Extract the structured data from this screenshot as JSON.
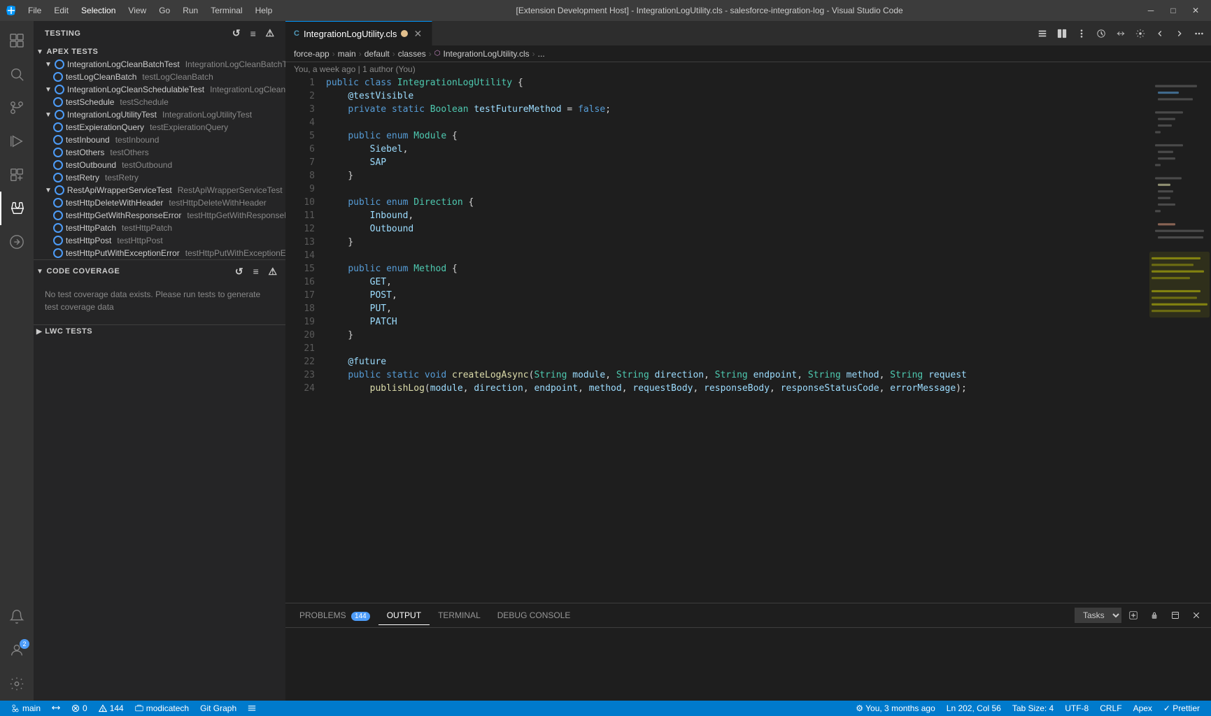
{
  "titlebar": {
    "title": "[Extension Development Host] - IntegrationLogUtility.cls - salesforce-integration-log - Visual Studio Code",
    "icon": "⬡",
    "menu": [
      "File",
      "Edit",
      "Selection",
      "View",
      "Go",
      "Run",
      "Terminal",
      "Help"
    ],
    "controls": {
      "minimize": "─",
      "maximize": "□",
      "close": "✕"
    }
  },
  "activitybar": {
    "items": [
      {
        "name": "explorer",
        "icon": "⊞",
        "active": false
      },
      {
        "name": "search",
        "icon": "🔍",
        "active": false
      },
      {
        "name": "source-control",
        "icon": "⑂",
        "active": false
      },
      {
        "name": "run-debug",
        "icon": "▷",
        "active": false
      },
      {
        "name": "extensions",
        "icon": "⊡",
        "active": false
      },
      {
        "name": "testing",
        "icon": "⚗",
        "active": true
      },
      {
        "name": "salesforce",
        "icon": "☁",
        "active": false
      },
      {
        "name": "bottom1",
        "icon": "🔔",
        "active": false
      },
      {
        "name": "bottom2",
        "icon": "👤",
        "badge": "2",
        "active": false
      },
      {
        "name": "settings",
        "icon": "⚙",
        "active": false
      }
    ]
  },
  "sidebar": {
    "title": "TESTING",
    "actions": [
      "↺",
      "≡",
      "⚠"
    ],
    "apex_section": {
      "label": "APEX TESTS",
      "expanded": true,
      "test_suites": [
        {
          "name": "IntegrationLogCleanBatchTest",
          "label": "IntegrationLogCleanBatchTest",
          "secondary": "IntegrationLogCleanBatchTest",
          "expanded": true,
          "children": [
            {
              "label": "testLogCleanBatch",
              "secondary": "testLogCleanBatch"
            }
          ]
        },
        {
          "name": "IntegrationLogCleanSchedulableTest",
          "label": "IntegrationLogCleanSchedulableTest",
          "secondary": "IntegrationLogCleanSchedula...",
          "expanded": true,
          "children": [
            {
              "label": "testSchedule",
              "secondary": "testSchedule"
            }
          ]
        },
        {
          "name": "IntegrationLogUtilityTest",
          "label": "IntegrationLogUtilityTest",
          "secondary": "IntegrationLogUtilityTest",
          "expanded": true,
          "children": [
            {
              "label": "testExpierationQuery",
              "secondary": "testExpierationQuery"
            },
            {
              "label": "testInbound",
              "secondary": "testInbound"
            },
            {
              "label": "testOthers",
              "secondary": "testOthers"
            },
            {
              "label": "testOutbound",
              "secondary": "testOutbound"
            },
            {
              "label": "testRetry",
              "secondary": "testRetry"
            }
          ]
        },
        {
          "name": "RestApiWrapperServiceTest",
          "label": "RestApiWrapperServiceTest",
          "secondary": "RestApiWrapperServiceTest",
          "expanded": true,
          "children": [
            {
              "label": "testHttpDeleteWithHeader",
              "secondary": "testHttpDeleteWithHeader"
            },
            {
              "label": "testHttpGetWithResponseError",
              "secondary": "testHttpGetWithResponseError"
            },
            {
              "label": "testHttpPatch",
              "secondary": "testHttpPatch"
            },
            {
              "label": "testHttpPost",
              "secondary": "testHttpPost"
            },
            {
              "label": "testHttpPutWithExceptionError",
              "secondary": "testHttpPutWithExceptionError"
            }
          ]
        }
      ]
    },
    "coverage_section": {
      "label": "CODE COVERAGE",
      "expanded": true,
      "actions": [
        "↺",
        "≡",
        "⚠"
      ],
      "message": "No test coverage data exists. Please run tests to generate test coverage data"
    },
    "lwc_section": {
      "label": "LWC TESTS",
      "expanded": false
    }
  },
  "editor": {
    "tabs": [
      {
        "label": "IntegrationLogUtility.cls",
        "icon": "C#",
        "active": true,
        "modified": true,
        "modified_char": "●"
      }
    ],
    "breadcrumb": {
      "path": [
        "force-app",
        "main",
        "default",
        "classes",
        "IntegrationLogUtility.cls",
        "..."
      ]
    },
    "git_blame": "You, a week ago | 1 author (You)",
    "toolbar_buttons": [
      "⬅",
      "⬛",
      "⚙",
      "◀",
      "▶",
      "⚙",
      "◀▶",
      "…"
    ],
    "code": {
      "lines": [
        {
          "num": 1,
          "content": "public class IntegrationLogUtility {"
        },
        {
          "num": 2,
          "content": "    @testVisible"
        },
        {
          "num": 3,
          "content": "    private static Boolean testFutureMethod = false;"
        },
        {
          "num": 4,
          "content": ""
        },
        {
          "num": 5,
          "content": "    public enum Module {"
        },
        {
          "num": 6,
          "content": "        Siebel,"
        },
        {
          "num": 7,
          "content": "        SAP"
        },
        {
          "num": 8,
          "content": "    }"
        },
        {
          "num": 9,
          "content": ""
        },
        {
          "num": 10,
          "content": "    public enum Direction {"
        },
        {
          "num": 11,
          "content": "        Inbound,"
        },
        {
          "num": 12,
          "content": "        Outbound"
        },
        {
          "num": 13,
          "content": "    }"
        },
        {
          "num": 14,
          "content": ""
        },
        {
          "num": 15,
          "content": "    public enum Method {"
        },
        {
          "num": 16,
          "content": "        GET,"
        },
        {
          "num": 17,
          "content": "        POST,"
        },
        {
          "num": 18,
          "content": "        PUT,"
        },
        {
          "num": 19,
          "content": "        PATCH"
        },
        {
          "num": 20,
          "content": "    }"
        },
        {
          "num": 21,
          "content": ""
        },
        {
          "num": 22,
          "content": "    @future"
        },
        {
          "num": 23,
          "content": "    public static void createLogAsync(String module, String direction, String endpoint, String method, String request"
        },
        {
          "num": 24,
          "content": "        publishLog(module, direction, endpoint, method, requestBody, responseBody, responseStatusCode, errorMessage);"
        }
      ]
    }
  },
  "panel": {
    "tabs": [
      {
        "label": "PROBLEMS",
        "active": false,
        "badge": "144"
      },
      {
        "label": "OUTPUT",
        "active": true,
        "badge": null
      },
      {
        "label": "TERMINAL",
        "active": false,
        "badge": null
      },
      {
        "label": "DEBUG CONSOLE",
        "active": false,
        "badge": null
      }
    ],
    "tasks_dropdown": {
      "options": [
        "Tasks"
      ],
      "selected": "Tasks"
    },
    "actions": [
      "⊞",
      "🔒",
      "✕",
      "▲",
      "✕"
    ]
  },
  "statusbar": {
    "left": [
      {
        "icon": "⑂",
        "label": "main",
        "name": "git-branch"
      },
      {
        "icon": "↺",
        "label": "",
        "name": "sync"
      },
      {
        "icon": "⊘",
        "label": "0",
        "name": "errors"
      },
      {
        "icon": "⚠",
        "label": "144",
        "name": "warnings"
      },
      {
        "icon": "📡",
        "label": "modicatech",
        "name": "remote"
      },
      {
        "label": "Git Graph",
        "name": "git-graph"
      },
      {
        "icon": "≡",
        "label": "",
        "name": "menu"
      }
    ],
    "right": [
      {
        "label": "Ln 202, Col 56",
        "name": "cursor-position"
      },
      {
        "label": "Tab Size: 4",
        "name": "tab-size"
      },
      {
        "label": "UTF-8",
        "name": "encoding"
      },
      {
        "label": "CRLF",
        "name": "line-ending"
      },
      {
        "label": "Apex",
        "name": "language-mode"
      },
      {
        "label": "✓ Prettier",
        "name": "prettier"
      }
    ],
    "right_info": "⚙ You, 3 months ago"
  }
}
